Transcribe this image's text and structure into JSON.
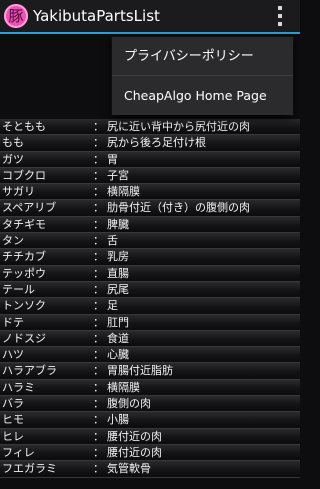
{
  "actionbar": {
    "icon_glyph": "豚",
    "title": "YakibutaPartsList",
    "overflow_icon": "more-vertical-icon",
    "accent_color": "#2aa0d6",
    "icon_color": "#f04fb7"
  },
  "menu": {
    "items": [
      {
        "label": "プライバシーポリシー"
      },
      {
        "label": "CheapAlgo Home Page"
      }
    ]
  },
  "list": {
    "separator": "：",
    "rows": [
      {
        "name": "そともも",
        "desc": "尻に近い背中から尻付近の肉"
      },
      {
        "name": "もも",
        "desc": "尻から後ろ足付け根"
      },
      {
        "name": "ガツ",
        "desc": "胃"
      },
      {
        "name": "コブクロ",
        "desc": "子宮"
      },
      {
        "name": "サガリ",
        "desc": "横隔膜"
      },
      {
        "name": "スペアリブ",
        "desc": "肋骨付近（付き）の腹側の肉"
      },
      {
        "name": "タチギモ",
        "desc": "脾臓"
      },
      {
        "name": "タン",
        "desc": "舌"
      },
      {
        "name": "チチカブ",
        "desc": "乳房"
      },
      {
        "name": "テッポウ",
        "desc": "直腸"
      },
      {
        "name": "テール",
        "desc": "尻尾"
      },
      {
        "name": "トンソク",
        "desc": "足"
      },
      {
        "name": "ドテ",
        "desc": "肛門"
      },
      {
        "name": "ノドスジ",
        "desc": "食道"
      },
      {
        "name": "ハツ",
        "desc": "心臓"
      },
      {
        "name": "ハラアブラ",
        "desc": "胃腸付近脂肪"
      },
      {
        "name": "ハラミ",
        "desc": "横隔膜"
      },
      {
        "name": "バラ",
        "desc": "腹側の肉"
      },
      {
        "name": "ヒモ",
        "desc": "小腸"
      },
      {
        "name": "ヒレ",
        "desc": "腰付近の肉"
      },
      {
        "name": "フィレ",
        "desc": "腰付近の肉"
      },
      {
        "name": "フエガラミ",
        "desc": "気管軟骨"
      }
    ]
  }
}
